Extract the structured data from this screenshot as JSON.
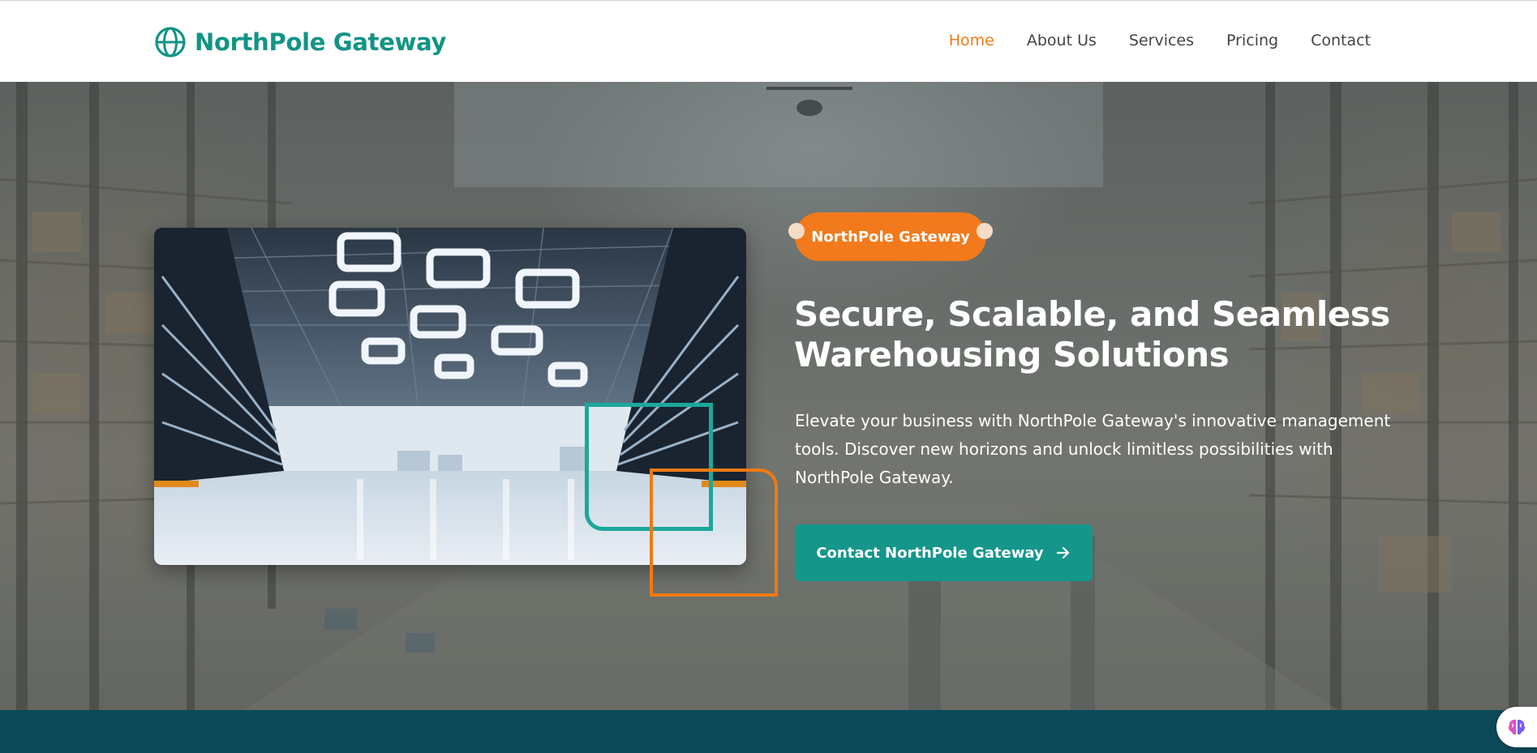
{
  "brand": {
    "name": "NorthPole Gateway",
    "icon": "globe-icon",
    "color": "#119486"
  },
  "nav": {
    "items": [
      {
        "label": "Home",
        "active": true
      },
      {
        "label": "About Us",
        "active": false
      },
      {
        "label": "Services",
        "active": false
      },
      {
        "label": "Pricing",
        "active": false
      },
      {
        "label": "Contact",
        "active": false
      }
    ],
    "active_color": "#f07a14"
  },
  "hero": {
    "badge": "NorthPole Gateway",
    "title": "Secure, Scalable, and Seamless Warehousing Solutions",
    "description": "Elevate your business with NorthPole Gateway's innovative management tools. Discover new horizons and unlock limitless possibilities with NorthPole Gateway.",
    "cta_label": "Contact NorthPole Gateway",
    "cta_icon": "arrow-right-icon",
    "image_alt": "warehouse-interior-image",
    "accent_teal": "#1ba89a",
    "accent_orange": "#f07a14"
  },
  "floating_button": {
    "icon": "brain-icon"
  }
}
